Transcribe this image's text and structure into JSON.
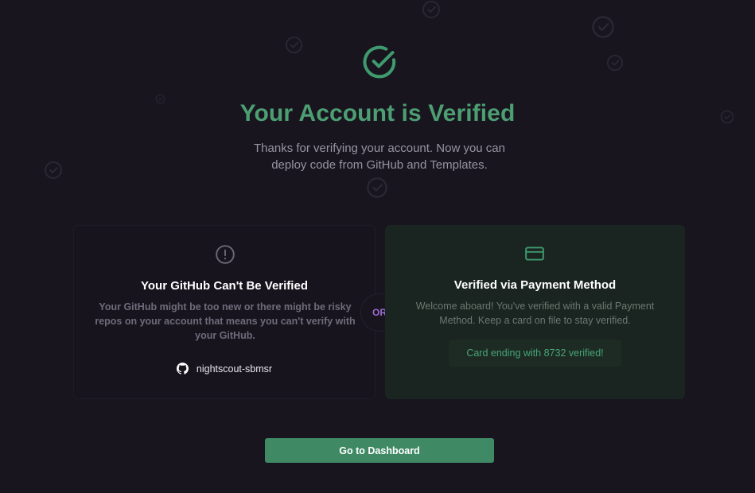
{
  "hero": {
    "icon": "check-circle-icon",
    "title": "Your Account is Verified",
    "subtitle": "Thanks for verifying your account. Now you can deploy code from GitHub and Templates."
  },
  "github_card": {
    "icon": "alert-circle-icon",
    "title": "Your GitHub Can't Be Verified",
    "text": "Your GitHub might be too new or there might be risky repos on your account that means you can't verify with your GitHub.",
    "github_icon": "github-icon",
    "username": "nightscout-sbmsr"
  },
  "divider": {
    "label": "OR"
  },
  "payment_card": {
    "icon": "credit-card-icon",
    "title": "Verified via Payment Method",
    "text": "Welcome aboard! You've verified with a valid Payment Method. Keep a card on file to stay verified.",
    "badge": "Card ending with 8732 verified!"
  },
  "cta": {
    "label": "Go to Dashboard"
  },
  "colors": {
    "background": "#18151f",
    "accent_green": "#4d9e72",
    "button_green": "#3f8a65",
    "or_purple": "#9c6bd0"
  }
}
